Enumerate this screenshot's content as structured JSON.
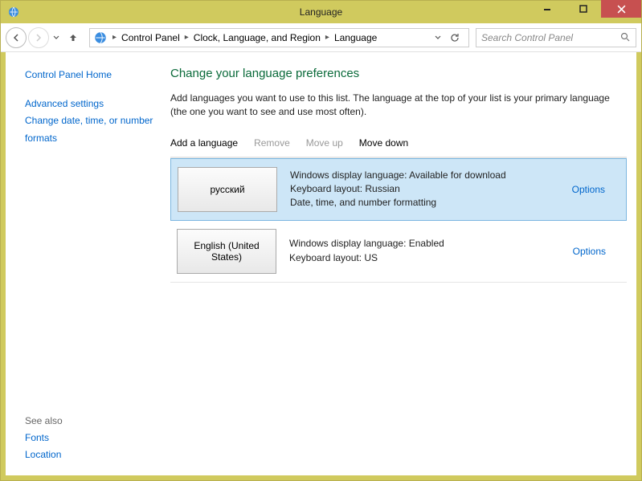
{
  "window": {
    "title": "Language"
  },
  "nav": {
    "breadcrumbs": [
      "Control Panel",
      "Clock, Language, and Region",
      "Language"
    ],
    "search_placeholder": "Search Control Panel"
  },
  "sidebar": {
    "home": "Control Panel Home",
    "links": [
      "Advanced settings",
      "Change date, time, or number formats"
    ],
    "seealso_label": "See also",
    "seealso": [
      "Fonts",
      "Location"
    ]
  },
  "main": {
    "heading": "Change your language preferences",
    "description": "Add languages you want to use to this list. The language at the top of your list is your primary language (the one you want to see and use most often).",
    "toolbar": {
      "add": "Add a language",
      "remove": "Remove",
      "moveup": "Move up",
      "movedown": "Move down"
    },
    "options_label": "Options",
    "languages": [
      {
        "tile": "русский",
        "details": "Windows display language: Available for download\nKeyboard layout: Russian\nDate, time, and number formatting",
        "selected": true
      },
      {
        "tile": "English (United States)",
        "details": "Windows display language: Enabled\nKeyboard layout: US",
        "selected": false
      }
    ]
  }
}
